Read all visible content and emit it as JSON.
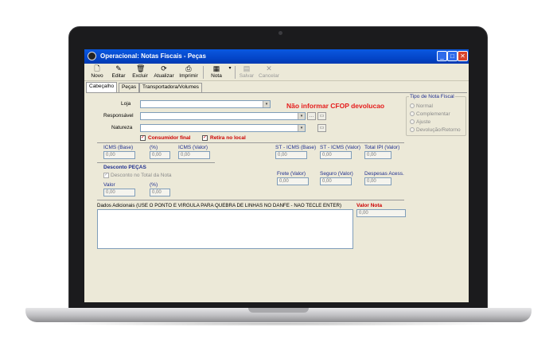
{
  "window": {
    "title": "Operacional: Notas Fiscais - Peças"
  },
  "toolbar": {
    "novo": "Novo",
    "editar": "Editar",
    "excluir": "Excluir",
    "atualizar": "Atualizar",
    "imprimir": "Imprimir",
    "nota": "Nota",
    "salvar": "Salvar",
    "cancelar": "Cancelar"
  },
  "tabs": [
    "Cabeçalho",
    "Peças",
    "Transportadora/Volumes"
  ],
  "form": {
    "loja_label": "Loja",
    "responsavel_label": "Responsável",
    "natureza_label": "Natureza",
    "warning": "Não informar CFOP devolucao",
    "consumidor_final": "Consumidor final",
    "retira_local": "Retira no local"
  },
  "tipo_nota": {
    "title": "Tipo de Nota Fiscal",
    "options": [
      "Normal",
      "Complementar",
      "Ajuste",
      "Devolução/Retorno"
    ]
  },
  "icms": {
    "base_label": "ICMS (Base)",
    "pct_label": "(%)",
    "valor_label": "ICMS (Valor)",
    "base": "0,00",
    "pct": "0,00",
    "valor": "0,00"
  },
  "st": {
    "base_label": "ST - ICMS (Base)",
    "valor_label": "ST - ICMS (Valor)",
    "total_ipi_label": "Total IPI (Valor)",
    "base": "0,00",
    "valor": "0,00",
    "total_ipi": "0,00"
  },
  "desconto": {
    "title": "Desconto PEÇAS",
    "no_total": "Desconto no Total da Nota",
    "valor_label": "Valor",
    "pct_label": "(%)",
    "valor": "0,00",
    "pct": "0,00"
  },
  "frete": {
    "frete_label": "Frete (Valor)",
    "seguro_label": "Seguro (Valor)",
    "despesas_label": "Despesas Acess.",
    "frete": "0,00",
    "seguro": "0,00",
    "despesas": "0,00"
  },
  "adicionais": {
    "label": "Dados Adicionais (USE O PONTO E VIRGULA PARA QUEBRA DE LINHAS NO DANFE - NAO TECLE ENTER)"
  },
  "valor_nota": {
    "label": "Valor Nota",
    "value": "0,00"
  },
  "colors": {
    "warning": "#e51b1b",
    "titlebar": "#0446c9",
    "label_blue": "#1f2f8f"
  }
}
